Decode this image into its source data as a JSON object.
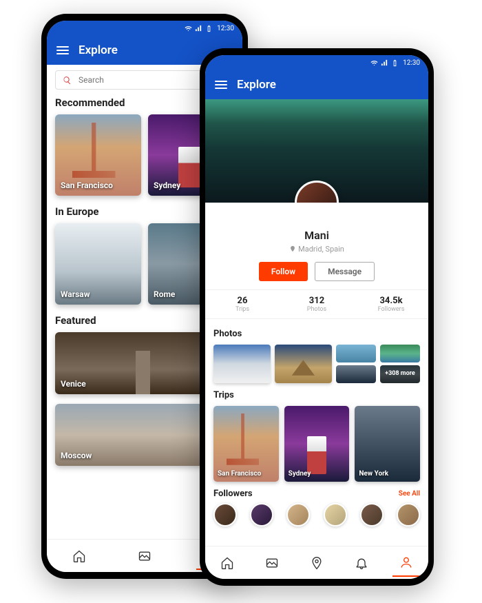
{
  "status": {
    "time": "12:30"
  },
  "left": {
    "title": "Explore",
    "search": {
      "placeholder": "Search"
    },
    "sections": {
      "recommended": {
        "title": "Recommended",
        "items": [
          "San Francisco",
          "Sydney"
        ]
      },
      "europe": {
        "title": "In Europe",
        "items": [
          "Warsaw",
          "Rome"
        ]
      },
      "featured": {
        "title": "Featured",
        "items": [
          "Venice",
          "Moscow"
        ]
      }
    }
  },
  "right": {
    "title": "Explore",
    "profile": {
      "name": "Mani",
      "location": "Madrid, Spain",
      "follow_label": "Follow",
      "message_label": "Message",
      "stats": {
        "trips": {
          "value": "26",
          "label": "Trips"
        },
        "photos": {
          "value": "312",
          "label": "Photos"
        },
        "followers": {
          "value": "34.5k",
          "label": "Followers"
        }
      }
    },
    "photos": {
      "title": "Photos",
      "more": "+308 more"
    },
    "trips": {
      "title": "Trips",
      "items": [
        "San Francisco",
        "Sydney",
        "New York"
      ]
    },
    "followers": {
      "title": "Followers",
      "see_all": "See All"
    }
  }
}
